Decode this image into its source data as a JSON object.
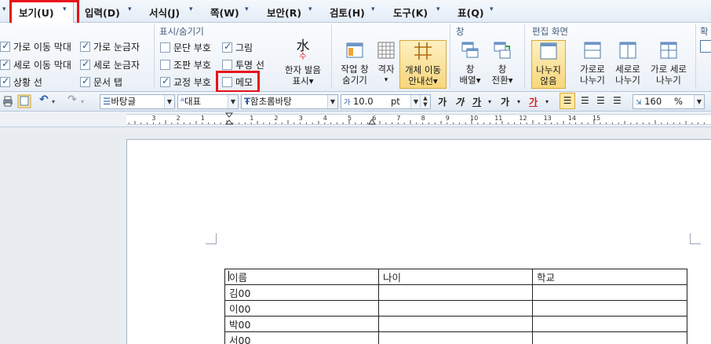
{
  "menu": {
    "items": [
      {
        "label": "보기(U)"
      },
      {
        "label": "입력(D)"
      },
      {
        "label": "서식(J)"
      },
      {
        "label": "쪽(W)"
      },
      {
        "label": "보안(R)"
      },
      {
        "label": "검토(H)"
      },
      {
        "label": "도구(K)"
      },
      {
        "label": "표(Q)"
      }
    ]
  },
  "ribbon": {
    "view_checks": [
      {
        "label": "가로 이동 막대",
        "checked": true
      },
      {
        "label": "가로 눈금자",
        "checked": true
      },
      {
        "label": "세로 이동 막대",
        "checked": true
      },
      {
        "label": "세로 눈금자",
        "checked": true
      },
      {
        "label": "상황 선",
        "checked": true
      },
      {
        "label": "문서 탭",
        "checked": true
      }
    ],
    "show_hide": {
      "title": "표시/숨기기",
      "checks": [
        {
          "label": "문단 부호",
          "checked": false
        },
        {
          "label": "그림",
          "checked": true
        },
        {
          "label": "조판 부호",
          "checked": false
        },
        {
          "label": "투명 선",
          "checked": false
        },
        {
          "label": "교정 부호",
          "checked": true
        },
        {
          "label": "메모",
          "checked": false
        }
      ]
    },
    "buttons": {
      "hanja_line1": "한자 발음",
      "hanja_line2": "표시▾",
      "hanja_glyph": "水",
      "hanja_sub": "수",
      "task_line1": "작업 창",
      "task_line2": "숨기기",
      "grid_line1": "격자",
      "grid_line2": "▾",
      "object_line1": "개체 이동",
      "object_line2": "안내선▾"
    },
    "window": {
      "title": "창",
      "arrange_line1": "창",
      "arrange_line2": "배열▾",
      "switch_line1": "창",
      "switch_line2": "전환▾"
    },
    "edit_screen": {
      "title": "편집 화면",
      "nosplit_line1": "나누지",
      "nosplit_line2": "않음",
      "hsplit_line1": "가로로",
      "hsplit_line2": "나누기",
      "vsplit_line1": "세로로",
      "vsplit_line2": "나누기",
      "hvsplit_line1": "가로 세로",
      "hvsplit_line2": "나누기"
    },
    "zoom_title": "확"
  },
  "format_toolbar": {
    "style": "바탕글",
    "lang": "대표",
    "font": "함초롬바탕",
    "size_value": "10.0",
    "size_unit": "pt",
    "bold": "가",
    "italic": "가",
    "underline": "가",
    "strike": "가",
    "fontcolor": "가",
    "zoom_value": "160",
    "zoom_unit": "%"
  },
  "ruler": {
    "numbers": [
      "3",
      "2",
      "1",
      "1",
      "2",
      "3",
      "4",
      "5",
      "6",
      "7",
      "8",
      "9",
      "10",
      "11",
      "12",
      "13",
      "14",
      "15"
    ]
  },
  "table": {
    "header": [
      "이름",
      "나이",
      "학교"
    ],
    "rows": [
      [
        "김00",
        "",
        ""
      ],
      [
        "이00",
        "",
        ""
      ],
      [
        "박00",
        "",
        ""
      ],
      [
        "서00",
        "",
        ""
      ]
    ]
  }
}
